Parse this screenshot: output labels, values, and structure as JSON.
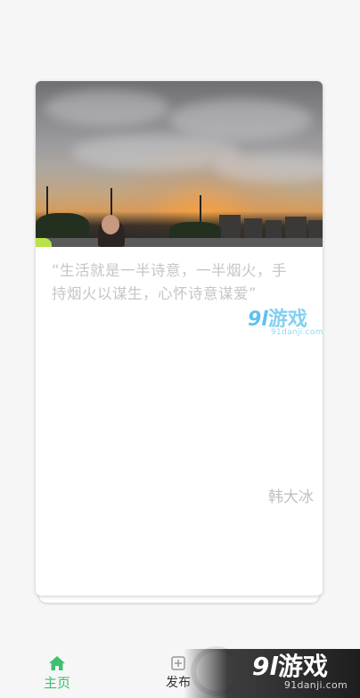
{
  "card": {
    "quote": "“生活就是一半诗意，一半烟火，手持烟火以谋生，心怀诗意谋爱”",
    "author": "韩大冰"
  },
  "nav": {
    "items": [
      {
        "label": "主页",
        "icon": "home-icon",
        "active": true
      },
      {
        "label": "发布",
        "icon": "add-icon",
        "active": false
      }
    ],
    "active_color": "#3ec06e"
  },
  "watermarks": {
    "brand_number": "9l",
    "brand_text": "游戏",
    "domain": "91danji.com"
  }
}
